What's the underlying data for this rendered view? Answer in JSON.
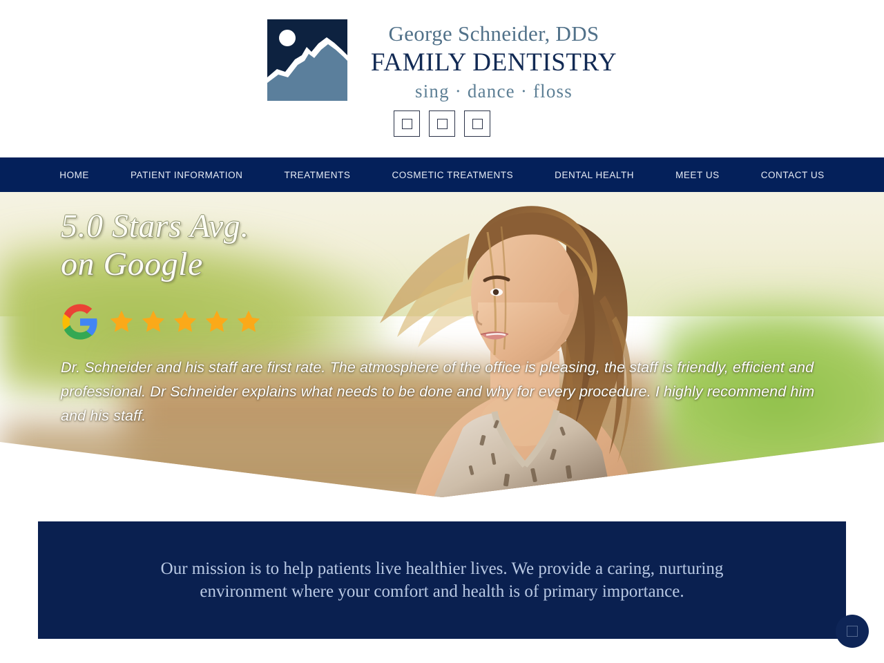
{
  "header": {
    "logo_icon": "mountain-moon-logo",
    "brand_name": "George Schneider, DDS",
    "brand_title": "FAMILY DENTISTRY",
    "brand_tagline": "sing · dance · floss",
    "social_icons": [
      {
        "name": "social-icon-1",
        "glyph": "placeholder-box"
      },
      {
        "name": "social-icon-2",
        "glyph": "placeholder-box"
      },
      {
        "name": "social-icon-3",
        "glyph": "placeholder-box"
      }
    ],
    "colors": {
      "brand_name_color": "#517189",
      "brand_title_color": "#122a54",
      "tagline_color": "#5d7f95",
      "logo_bg": "#0d2240"
    }
  },
  "nav": {
    "background": "#04205a",
    "items": [
      {
        "label": "HOME"
      },
      {
        "label": "PATIENT INFORMATION"
      },
      {
        "label": "TREATMENTS"
      },
      {
        "label": "COSMETIC TREATMENTS"
      },
      {
        "label": "DENTAL HEALTH"
      },
      {
        "label": "MEET US"
      },
      {
        "label": "CONTACT US"
      }
    ]
  },
  "hero": {
    "headline_line1": "5.0 Stars Avg.",
    "headline_line2": "on Google",
    "rating_logo": "google-g-icon",
    "star_count": 5,
    "star_color": "#fba919",
    "testimonial": "Dr. Schneider and his staff are first rate. The atmosphere of the office is pleasing, the staff is friendly, efficient and professional. Dr Schneider explains what needs to be done and why for every procedure. I highly recommend him and his staff.",
    "image_description": "smiling-woman-outdoors"
  },
  "mission": {
    "text": "Our mission is to help patients live healthier lives. We provide a caring, nurturing environment where your comfort and health is of primary importance.",
    "background": "#0a2050",
    "text_color": "#b9c9e4"
  },
  "chat": {
    "icon": "chat-widget-icon"
  }
}
